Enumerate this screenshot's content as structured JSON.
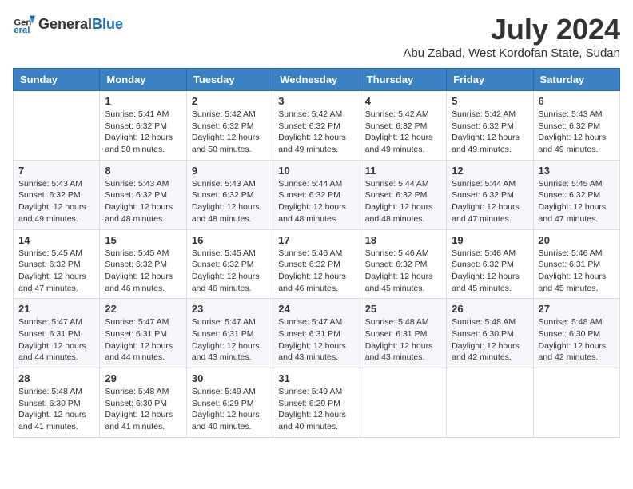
{
  "header": {
    "logo_general": "General",
    "logo_blue": "Blue",
    "main_title": "July 2024",
    "subtitle": "Abu Zabad, West Kordofan State, Sudan"
  },
  "calendar": {
    "days_of_week": [
      "Sunday",
      "Monday",
      "Tuesday",
      "Wednesday",
      "Thursday",
      "Friday",
      "Saturday"
    ],
    "weeks": [
      [
        {
          "day": "",
          "info": ""
        },
        {
          "day": "1",
          "info": "Sunrise: 5:41 AM\nSunset: 6:32 PM\nDaylight: 12 hours\nand 50 minutes."
        },
        {
          "day": "2",
          "info": "Sunrise: 5:42 AM\nSunset: 6:32 PM\nDaylight: 12 hours\nand 50 minutes."
        },
        {
          "day": "3",
          "info": "Sunrise: 5:42 AM\nSunset: 6:32 PM\nDaylight: 12 hours\nand 49 minutes."
        },
        {
          "day": "4",
          "info": "Sunrise: 5:42 AM\nSunset: 6:32 PM\nDaylight: 12 hours\nand 49 minutes."
        },
        {
          "day": "5",
          "info": "Sunrise: 5:42 AM\nSunset: 6:32 PM\nDaylight: 12 hours\nand 49 minutes."
        },
        {
          "day": "6",
          "info": "Sunrise: 5:43 AM\nSunset: 6:32 PM\nDaylight: 12 hours\nand 49 minutes."
        }
      ],
      [
        {
          "day": "7",
          "info": "Sunrise: 5:43 AM\nSunset: 6:32 PM\nDaylight: 12 hours\nand 49 minutes."
        },
        {
          "day": "8",
          "info": "Sunrise: 5:43 AM\nSunset: 6:32 PM\nDaylight: 12 hours\nand 48 minutes."
        },
        {
          "day": "9",
          "info": "Sunrise: 5:43 AM\nSunset: 6:32 PM\nDaylight: 12 hours\nand 48 minutes."
        },
        {
          "day": "10",
          "info": "Sunrise: 5:44 AM\nSunset: 6:32 PM\nDaylight: 12 hours\nand 48 minutes."
        },
        {
          "day": "11",
          "info": "Sunrise: 5:44 AM\nSunset: 6:32 PM\nDaylight: 12 hours\nand 48 minutes."
        },
        {
          "day": "12",
          "info": "Sunrise: 5:44 AM\nSunset: 6:32 PM\nDaylight: 12 hours\nand 47 minutes."
        },
        {
          "day": "13",
          "info": "Sunrise: 5:45 AM\nSunset: 6:32 PM\nDaylight: 12 hours\nand 47 minutes."
        }
      ],
      [
        {
          "day": "14",
          "info": "Sunrise: 5:45 AM\nSunset: 6:32 PM\nDaylight: 12 hours\nand 47 minutes."
        },
        {
          "day": "15",
          "info": "Sunrise: 5:45 AM\nSunset: 6:32 PM\nDaylight: 12 hours\nand 46 minutes."
        },
        {
          "day": "16",
          "info": "Sunrise: 5:45 AM\nSunset: 6:32 PM\nDaylight: 12 hours\nand 46 minutes."
        },
        {
          "day": "17",
          "info": "Sunrise: 5:46 AM\nSunset: 6:32 PM\nDaylight: 12 hours\nand 46 minutes."
        },
        {
          "day": "18",
          "info": "Sunrise: 5:46 AM\nSunset: 6:32 PM\nDaylight: 12 hours\nand 45 minutes."
        },
        {
          "day": "19",
          "info": "Sunrise: 5:46 AM\nSunset: 6:32 PM\nDaylight: 12 hours\nand 45 minutes."
        },
        {
          "day": "20",
          "info": "Sunrise: 5:46 AM\nSunset: 6:31 PM\nDaylight: 12 hours\nand 45 minutes."
        }
      ],
      [
        {
          "day": "21",
          "info": "Sunrise: 5:47 AM\nSunset: 6:31 PM\nDaylight: 12 hours\nand 44 minutes."
        },
        {
          "day": "22",
          "info": "Sunrise: 5:47 AM\nSunset: 6:31 PM\nDaylight: 12 hours\nand 44 minutes."
        },
        {
          "day": "23",
          "info": "Sunrise: 5:47 AM\nSunset: 6:31 PM\nDaylight: 12 hours\nand 43 minutes."
        },
        {
          "day": "24",
          "info": "Sunrise: 5:47 AM\nSunset: 6:31 PM\nDaylight: 12 hours\nand 43 minutes."
        },
        {
          "day": "25",
          "info": "Sunrise: 5:48 AM\nSunset: 6:31 PM\nDaylight: 12 hours\nand 43 minutes."
        },
        {
          "day": "26",
          "info": "Sunrise: 5:48 AM\nSunset: 6:30 PM\nDaylight: 12 hours\nand 42 minutes."
        },
        {
          "day": "27",
          "info": "Sunrise: 5:48 AM\nSunset: 6:30 PM\nDaylight: 12 hours\nand 42 minutes."
        }
      ],
      [
        {
          "day": "28",
          "info": "Sunrise: 5:48 AM\nSunset: 6:30 PM\nDaylight: 12 hours\nand 41 minutes."
        },
        {
          "day": "29",
          "info": "Sunrise: 5:48 AM\nSunset: 6:30 PM\nDaylight: 12 hours\nand 41 minutes."
        },
        {
          "day": "30",
          "info": "Sunrise: 5:49 AM\nSunset: 6:29 PM\nDaylight: 12 hours\nand 40 minutes."
        },
        {
          "day": "31",
          "info": "Sunrise: 5:49 AM\nSunset: 6:29 PM\nDaylight: 12 hours\nand 40 minutes."
        },
        {
          "day": "",
          "info": ""
        },
        {
          "day": "",
          "info": ""
        },
        {
          "day": "",
          "info": ""
        }
      ]
    ]
  }
}
